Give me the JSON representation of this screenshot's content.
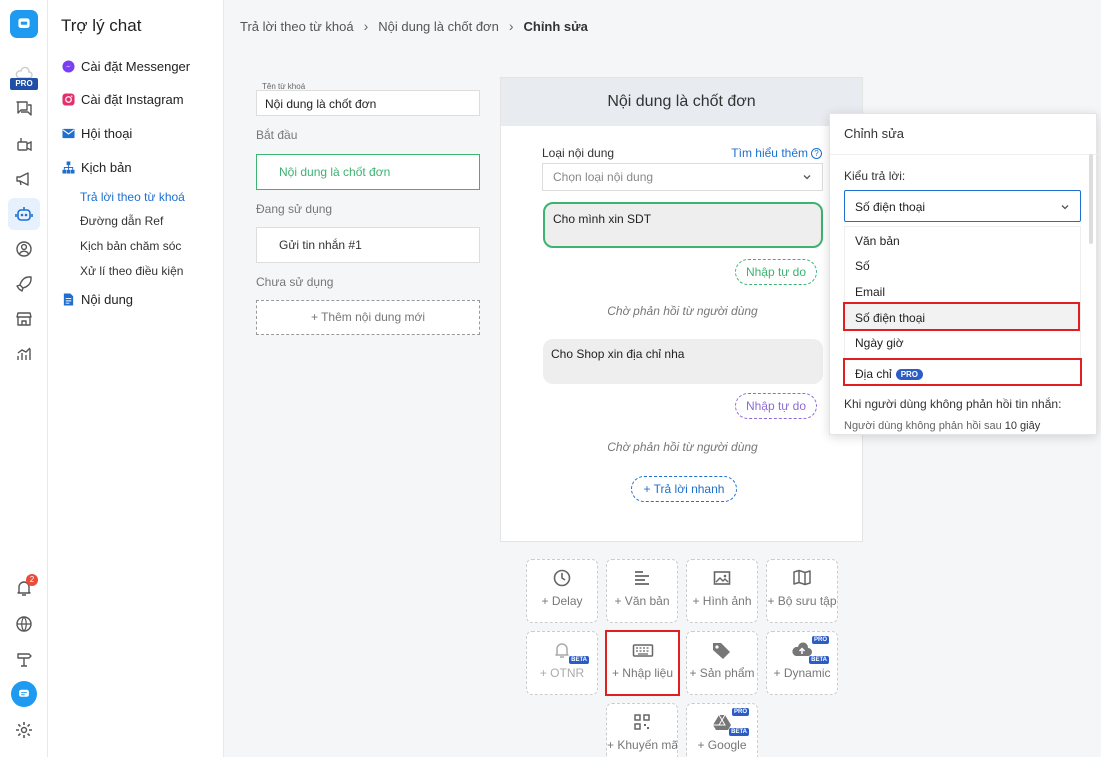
{
  "sidebar": {
    "title": "Trợ lý chat",
    "items": [
      {
        "label": "Cài đặt Messenger",
        "icon": "messenger-icon"
      },
      {
        "label": "Cài đặt Instagram",
        "icon": "instagram-icon"
      },
      {
        "label": "Hội thoại",
        "icon": "mail-icon"
      },
      {
        "label": "Kịch bản",
        "icon": "sitemap-icon"
      },
      {
        "label": "Nội dung",
        "icon": "document-icon"
      }
    ],
    "sub_items": [
      {
        "label": "Trả lời theo từ khoá",
        "active": true
      },
      {
        "label": "Đường dẫn Ref",
        "active": false
      },
      {
        "label": "Kịch bản chăm sóc",
        "active": false
      },
      {
        "label": "Xử lí theo điều kiện",
        "active": false
      }
    ]
  },
  "rail": {
    "pro_label": "PRO",
    "notification_count": "2"
  },
  "breadcrumb": [
    "Trả lời theo từ khoá",
    "Nội dung là chốt đơn",
    "Chỉnh sửa"
  ],
  "keyword": {
    "field_label": "Tên từ khoá",
    "value": "Nội dung là chốt đơn",
    "start_label": "Bắt đầu",
    "start_card": "Nội dung là chốt đơn",
    "in_use_label": "Đang sử dụng",
    "in_use_card": "Gửi tin nhắn #1",
    "unused_label": "Chưa sử dụng",
    "add_content": "+ Thêm nội dung mới"
  },
  "center": {
    "title": "Nội dung là chốt đơn",
    "content_type_label": "Loại nội dung",
    "learn_more": "Tìm hiểu thêm",
    "content_type_placeholder": "Chọn loại nội dung",
    "messages": [
      {
        "text": "Cho mình xin  SDT",
        "input_label": "Nhập tự do"
      },
      {
        "text": "Cho Shop xin địa chỉ nha",
        "input_label": "Nhập tự do"
      }
    ],
    "waiting_text": "Chờ phản hồi từ người dùng",
    "quick_reply": "+ Trả lời nhanh"
  },
  "tools": [
    {
      "label": "+ Delay",
      "icon": "clock-icon"
    },
    {
      "label": "+ Văn bản",
      "icon": "text-icon"
    },
    {
      "label": "+ Hình ảnh",
      "icon": "image-icon"
    },
    {
      "label": "+ Bộ sưu tập",
      "icon": "map-icon"
    },
    {
      "label": "+ OTNR",
      "icon": "bell-icon",
      "badge": "BETA"
    },
    {
      "label": "+ Nhập liệu",
      "icon": "keyboard-icon"
    },
    {
      "label": "+ Sản phẩm",
      "icon": "tag-icon"
    },
    {
      "label": "+ Dynamic",
      "icon": "cloud-upload-icon",
      "badges": [
        "PRO",
        "BETA"
      ]
    },
    {
      "label": "+ Khuyến mãi",
      "icon": "qr-icon"
    },
    {
      "label": "+ Google",
      "icon": "google-drive-icon",
      "badges": [
        "PRO",
        "BETA"
      ]
    }
  ],
  "edit_panel": {
    "title": "Chỉnh sửa",
    "reply_type_label": "Kiểu trả lời:",
    "selected": "Số điện thoại",
    "options": [
      "Văn bản",
      "Số",
      "Email",
      "Số điện thoại",
      "Ngày giờ",
      "Địa chỉ"
    ],
    "pro_label": "PRO",
    "no_reply_label": "Khi người dùng không phản hồi tin nhắn:",
    "no_reply_text": "Người dùng không phản hồi sau",
    "no_reply_value": "10 giây"
  },
  "colors": {
    "accent": "#1e6fd0",
    "green": "#3cb371",
    "highlight": "#e02020",
    "brand": "#1e9bf0"
  }
}
